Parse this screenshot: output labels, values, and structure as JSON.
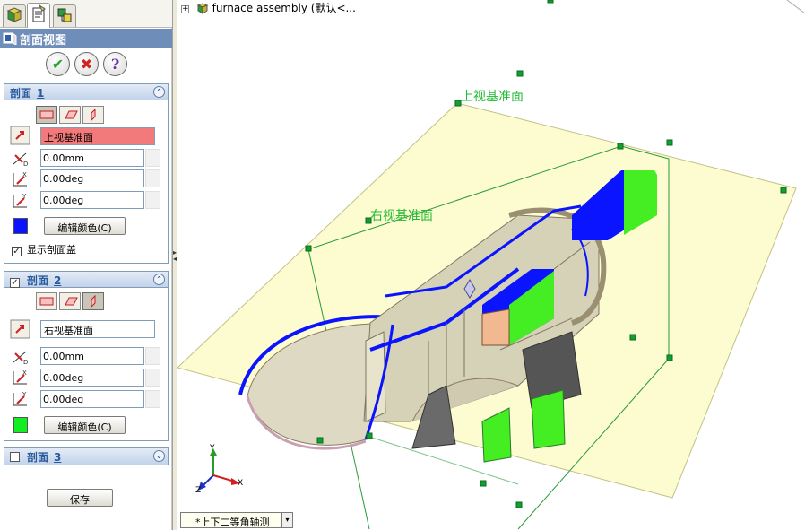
{
  "panel": {
    "title": "剖面视图",
    "actions": {
      "ok": "✔",
      "cancel": "✖",
      "help": "?"
    },
    "section1": {
      "label": "剖面",
      "number": "1",
      "plane": "上视基准面",
      "offset": "0.00mm",
      "rot_x": "0.00deg",
      "rot_y": "0.00deg",
      "color": "#0a14ff",
      "edit_color": "编辑颜色(C)",
      "show_cap": "显示剖面盖",
      "show_cap_checked": "✓"
    },
    "section2": {
      "label": "剖面",
      "number": "2",
      "checked": "✓",
      "plane": "右视基准面",
      "offset": "0.00mm",
      "rot_x": "0.00deg",
      "rot_y": "0.00deg",
      "color": "#11ee22",
      "edit_color": "编辑颜色(C)"
    },
    "section3": {
      "label": "剖面",
      "number": "3"
    },
    "save": "保存",
    "icons": {
      "expand": "⌃",
      "collapse": "⌄"
    }
  },
  "viewport": {
    "tree_item": "furnace assembly  (默认<...",
    "tree_expander": "+",
    "plane_top": "上视基准面",
    "plane_right": "右视基准面",
    "view_orientation": "*上下二等角轴测",
    "dropdown": "▾",
    "triad": {
      "x": "X",
      "y": "Y",
      "z": "Z"
    }
  },
  "colors": {
    "plane_fill": "#fdfbc8",
    "section_blue": "#0a14ff",
    "section_green": "#44ee22",
    "model_body": "#d6d2b8",
    "header_blue": "#6e8db8"
  }
}
